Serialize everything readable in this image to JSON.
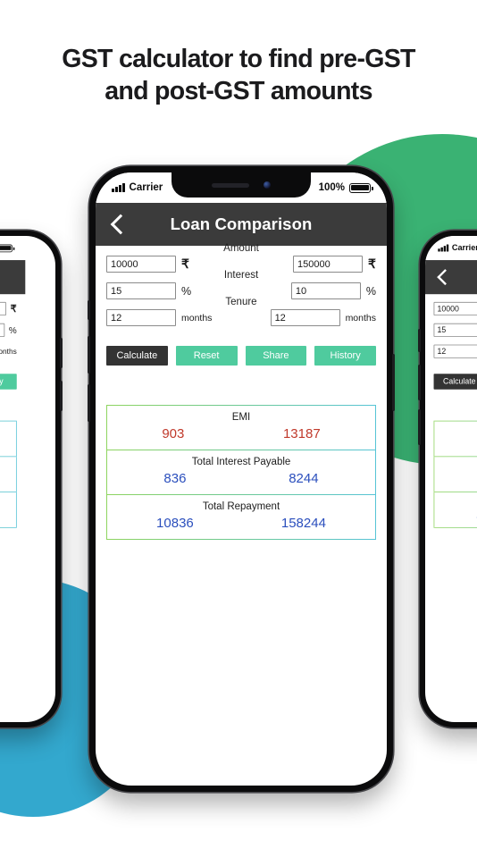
{
  "headline": {
    "line1": "GST calculator to find pre-GST",
    "line2": "and post-GST amounts"
  },
  "theme": {
    "blob_green": "#3ab273",
    "blob_blue": "#33a8ce",
    "button_green": "#4fcb9e",
    "button_dark": "#333333",
    "appbar_dark": "#3b3b3b",
    "value_red": "#c0392b",
    "value_blue": "#2b4fbd",
    "table_border_start": "#8ed45f",
    "table_border_end": "#56c4d6"
  },
  "statusbar": {
    "carrier": "Carrier",
    "battery_percent": "100%",
    "signal_icon": "signal-bars-icon",
    "battery_icon": "battery-full-icon"
  },
  "appbar": {
    "back_icon": "back-chevron-icon",
    "title": "Loan Comparison"
  },
  "form": {
    "rows": [
      {
        "label": "Amount",
        "left_value": "10000",
        "left_unit": "₹",
        "right_value": "150000",
        "right_unit": "₹",
        "placeholder": "Amount"
      },
      {
        "label": "Interest",
        "left_value": "15",
        "left_unit": "%",
        "right_value": "10",
        "right_unit": "%",
        "placeholder": "Interest"
      },
      {
        "label": "Tenure",
        "left_value": "12",
        "left_unit": "months",
        "right_value": "12",
        "right_unit": "months",
        "placeholder": "Tenure"
      }
    ]
  },
  "buttons": {
    "calculate": "Calculate",
    "reset": "Reset",
    "share": "Share",
    "history": "History"
  },
  "results": {
    "rows": [
      {
        "label": "EMI",
        "left": "903",
        "right": "13187"
      },
      {
        "label": "Total Interest Payable",
        "left": "836",
        "right": "8244"
      },
      {
        "label": "Total Repayment",
        "left": "10836",
        "right": "158244"
      }
    ]
  }
}
